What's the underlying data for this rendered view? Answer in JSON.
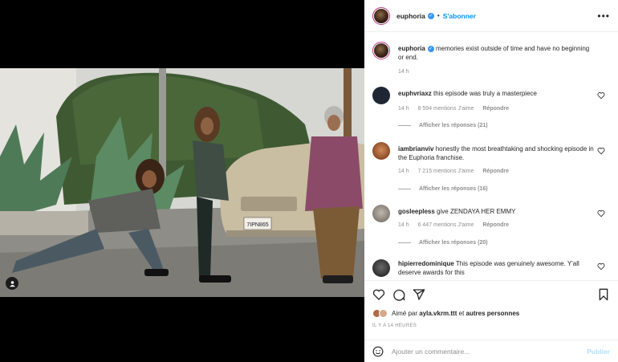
{
  "post": {
    "username": "euphoria",
    "follow_label": "S'abonner",
    "dot": "•",
    "more_label": "•••",
    "caption": "memories exist outside of time and have no beginning or end.",
    "caption_time": "14 h",
    "photo": {
      "license_plate": "7IPN865"
    }
  },
  "comments": [
    {
      "user": "euphvriaxz",
      "text": "this episode was truly a masterpiece",
      "time": "14 h",
      "likes": "8 594 mentions J'aime",
      "reply": "Répondre",
      "replies": "Afficher les réponses (21)",
      "avatar_color": "#1e2533"
    },
    {
      "user": "iambrianviv",
      "text": "honestly the most breathtaking and shocking episode in the Euphoria franchise.",
      "time": "14 h",
      "likes": "7 215 mentions J'aime",
      "reply": "Répondre",
      "replies": "Afficher les réponses (16)",
      "avatar_color": "#b86a3c"
    },
    {
      "user": "gosleepless",
      "text": "give ZENDAYA HER EMMY",
      "time": "14 h",
      "likes": "6 447 mentions J'aime",
      "reply": "Répondre",
      "replies": "Afficher les réponses (20)",
      "avatar_color": "#9a948c"
    },
    {
      "user": "hipierredominique",
      "text": "This episode was genuinely awesome. Y'all deserve awards for this",
      "avatar_color": "#3b3b3b"
    }
  ],
  "actions": {
    "liked_prefix": "Aimé par",
    "liked_user": "ayla.vkrm.ttt",
    "liked_and": "et",
    "liked_others": "autres personnes",
    "time_ago": "IL Y A 14 HEURES"
  },
  "comment_box": {
    "placeholder": "Ajouter un commentaire...",
    "publish_label": "Publier"
  },
  "colors": {
    "accent": "#0095f6",
    "verified": "#3897f0",
    "publish_disabled": "#b2dffc",
    "muted": "#8e8e8e"
  }
}
